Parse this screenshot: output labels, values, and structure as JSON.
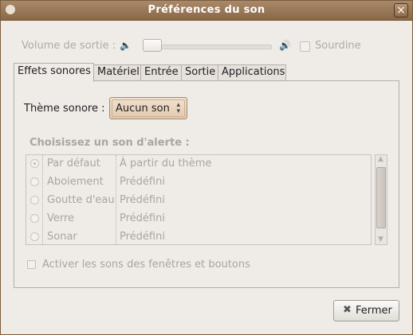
{
  "window": {
    "title": "Préférences du son"
  },
  "volume": {
    "label": "Volume de sortie :",
    "level": 0.0,
    "mute_label": "Sourdine"
  },
  "tabs": [
    {
      "label": "Effets sonores",
      "active": true
    },
    {
      "label": "Matériel",
      "active": false
    },
    {
      "label": "Entrée",
      "active": false
    },
    {
      "label": "Sortie",
      "active": false
    },
    {
      "label": "Applications",
      "active": false
    }
  ],
  "theme": {
    "label": "Thème sonore :",
    "value": "Aucun son"
  },
  "alerts": {
    "header": "Choisissez un son d'alerte :",
    "rows": [
      {
        "name": "Par défaut",
        "source": "À partir du thème",
        "selected": true
      },
      {
        "name": "Aboiement",
        "source": "Prédéfini",
        "selected": false
      },
      {
        "name": "Goutte d'eau",
        "source": "Prédéfini",
        "selected": false
      },
      {
        "name": "Verre",
        "source": "Prédéfini",
        "selected": false
      },
      {
        "name": "Sonar",
        "source": "Prédéfini",
        "selected": false
      }
    ]
  },
  "activate": {
    "label": "Activer les sons des fenêtres et boutons"
  },
  "footer": {
    "close_label": "Fermer"
  },
  "colors": {
    "titlebar": "#8a6846",
    "background": "#efebe7",
    "combo": "#e3c9af"
  }
}
